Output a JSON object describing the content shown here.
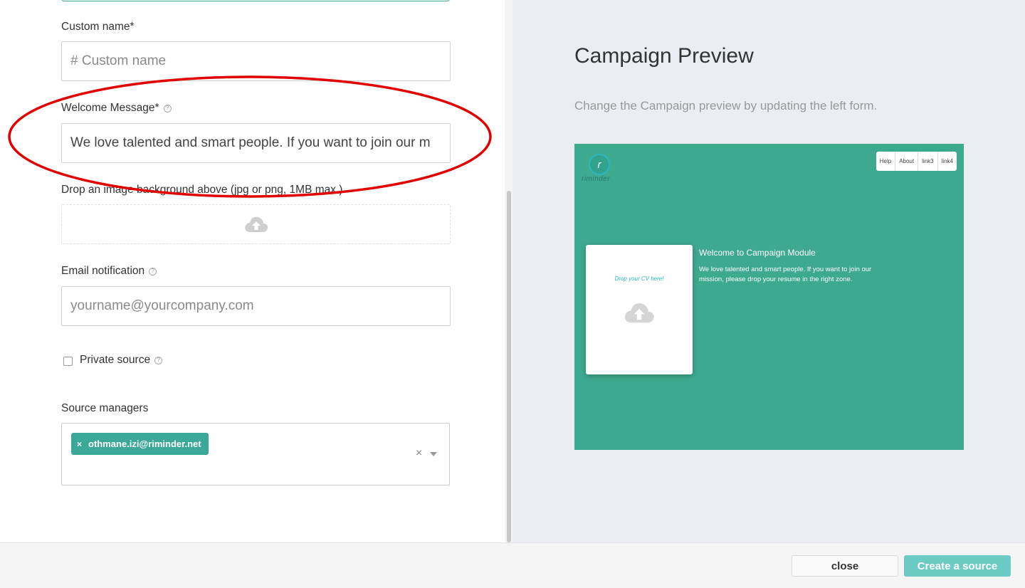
{
  "form": {
    "custom_name": {
      "label": "Custom name*",
      "placeholder": "# Custom name"
    },
    "welcome_message": {
      "label": "Welcome Message*",
      "help_icon": "question-circle-icon",
      "value": "We love talented and smart people. If you want to join our m"
    },
    "image_background": {
      "label": "Drop an image background above (jpg or png, 1MB max )",
      "icon": "cloud-upload-icon"
    },
    "email_notification": {
      "label": "Email notification",
      "help_icon": "question-circle-icon",
      "placeholder": "yourname@yourcompany.com"
    },
    "private_source": {
      "label": "Private source",
      "checked": false,
      "help_icon": "question-circle-icon"
    },
    "source_managers": {
      "label": "Source managers",
      "tags": [
        {
          "remove": "×",
          "label": "othmane.izi@riminder.net"
        }
      ],
      "clear": "×"
    }
  },
  "annotation": {
    "color": "#e00000",
    "shape": "ellipse"
  },
  "preview": {
    "title": "Campaign Preview",
    "subtitle": "Change the Campaign preview by updating the left form.",
    "mock": {
      "background": "#3daa8f",
      "logo_mark": "r",
      "logo_text": "riminder",
      "nav": [
        "Help",
        "About",
        "link3",
        "link4"
      ],
      "drop_text": "Drop your CV here!",
      "welcome_title": "Welcome to Campaign Module",
      "welcome_body": "We love talented and smart people. If you want to join our mission, please drop your resume in the right zone."
    }
  },
  "footer": {
    "close_label": "close",
    "create_label": "Create a source",
    "create_color": "#6ccbc4"
  }
}
